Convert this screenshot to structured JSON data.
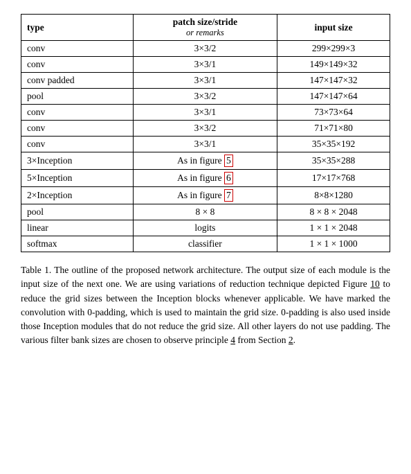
{
  "table": {
    "headers": {
      "type": "type",
      "patch": "patch size/stride",
      "patch_sub": "or remarks",
      "input": "input size"
    },
    "rows": [
      {
        "type": "conv",
        "patch": "3×3/2",
        "input": "299×299×3",
        "patch_highlighted": false
      },
      {
        "type": "conv",
        "patch": "3×3/1",
        "input": "149×149×32",
        "patch_highlighted": false
      },
      {
        "type": "conv padded",
        "patch": "3×3/1",
        "input": "147×147×32",
        "patch_highlighted": false
      },
      {
        "type": "pool",
        "patch": "3×3/2",
        "input": "147×147×64",
        "patch_highlighted": false
      },
      {
        "type": "conv",
        "patch": "3×3/1",
        "input": "73×73×64",
        "patch_highlighted": false
      },
      {
        "type": "conv",
        "patch": "3×3/2",
        "input": "71×71×80",
        "patch_highlighted": false
      },
      {
        "type": "conv",
        "patch": "3×3/1",
        "input": "35×35×192",
        "patch_highlighted": false
      },
      {
        "type": "3×Inception",
        "patch": "As in figure 5",
        "input": "35×35×288",
        "patch_highlighted": true,
        "figure_num": "5"
      },
      {
        "type": "5×Inception",
        "patch": "As in figure 6",
        "input": "17×17×768",
        "patch_highlighted": true,
        "figure_num": "6"
      },
      {
        "type": "2×Inception",
        "patch": "As in figure 7",
        "input": "8×8×1280",
        "patch_highlighted": true,
        "figure_num": "7"
      },
      {
        "type": "pool",
        "patch": "8 × 8",
        "input": "8 × 8 × 2048",
        "patch_highlighted": false
      },
      {
        "type": "linear",
        "patch": "logits",
        "input": "1 × 1 × 2048",
        "patch_highlighted": false
      },
      {
        "type": "softmax",
        "patch": "classifier",
        "input": "1 × 1 × 1000",
        "patch_highlighted": false
      }
    ]
  },
  "caption": {
    "text_parts": [
      {
        "text": "Table 1. The outline of the proposed network architecture.  The output size of each module is the input size of the next one.  We are using variations of reduction technique depicted Figure ",
        "type": "normal"
      },
      {
        "text": "10",
        "type": "link"
      },
      {
        "text": " to reduce the grid sizes between the Inception blocks whenever applicable. We have marked the convolution with 0-padding, which is used to maintain the grid size.  0-padding is also used inside those Inception modules that do not reduce the grid size. All other layers do not use padding. The various filter bank sizes are chosen to observe principle ",
        "type": "normal"
      },
      {
        "text": "4",
        "type": "link"
      },
      {
        "text": " from Section ",
        "type": "normal"
      },
      {
        "text": "2",
        "type": "link"
      },
      {
        "text": ".",
        "type": "normal"
      }
    ]
  }
}
